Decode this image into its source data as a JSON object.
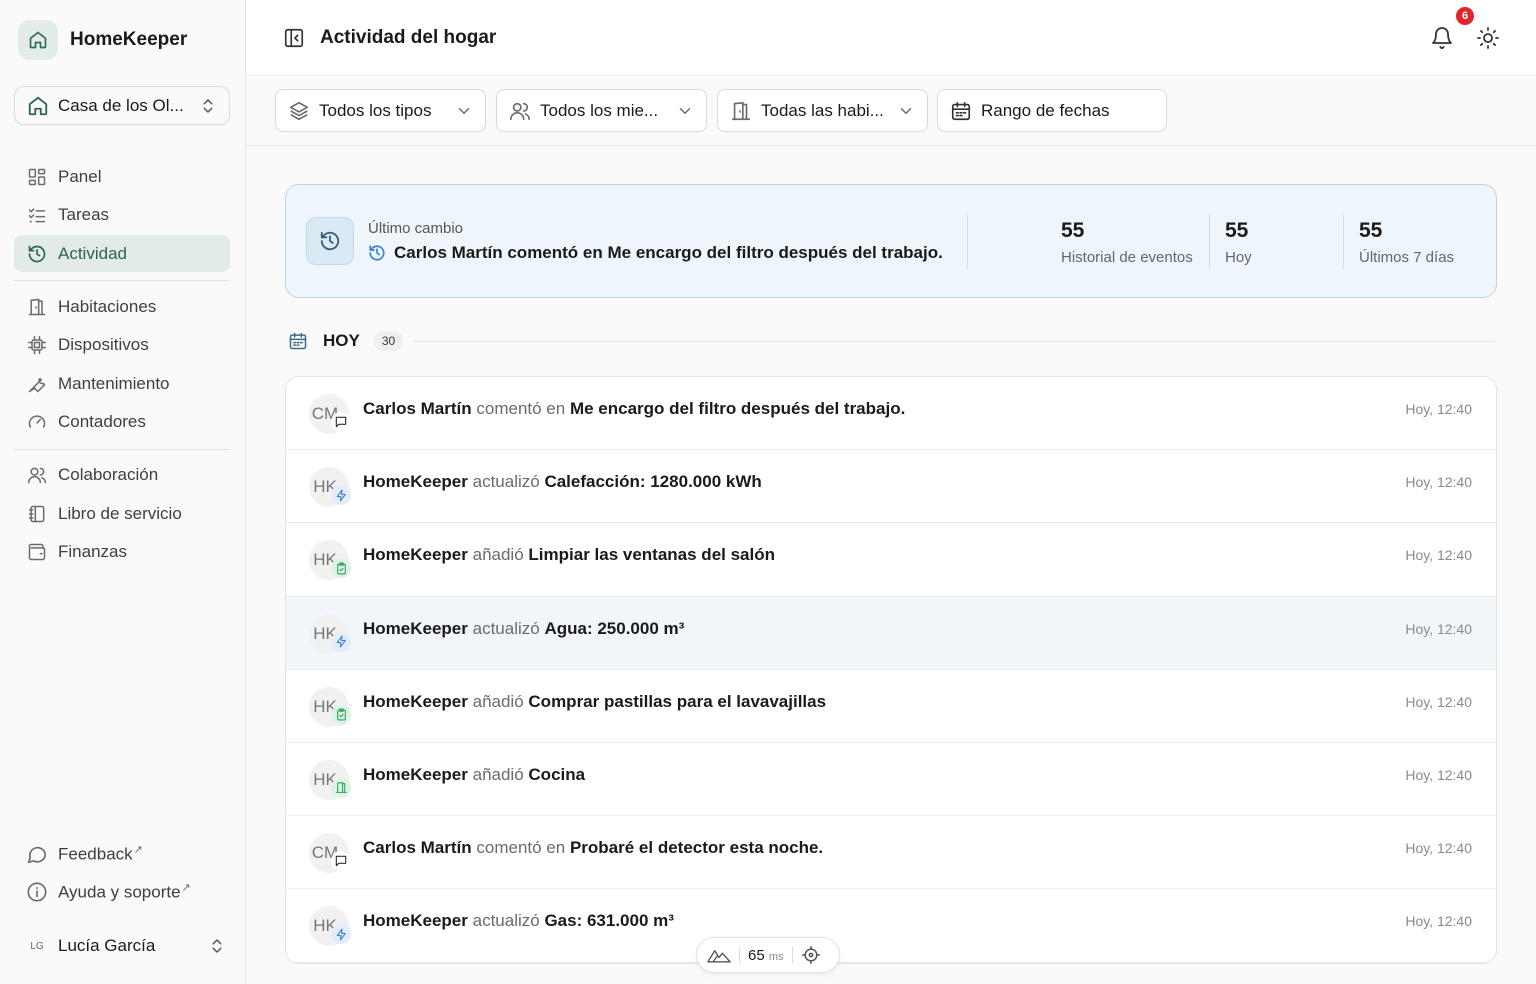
{
  "app": {
    "name": "HomeKeeper"
  },
  "home_selector": {
    "value": "Casa de los Ol..."
  },
  "nav": {
    "primary": [
      {
        "label": "Panel",
        "icon": "grid-icon"
      },
      {
        "label": "Tareas",
        "icon": "list-check-icon"
      },
      {
        "label": "Actividad",
        "icon": "history-icon",
        "active": true
      }
    ],
    "secondary": [
      {
        "label": "Habitaciones",
        "icon": "door-icon"
      },
      {
        "label": "Dispositivos",
        "icon": "chip-icon"
      },
      {
        "label": "Mantenimiento",
        "icon": "wrench-icon"
      },
      {
        "label": "Contadores",
        "icon": "gauge-icon"
      }
    ],
    "tertiary": [
      {
        "label": "Colaboración",
        "icon": "users-icon"
      },
      {
        "label": "Libro de servicio",
        "icon": "notebook-icon"
      },
      {
        "label": "Finanzas",
        "icon": "wallet-icon"
      }
    ],
    "footer": [
      {
        "label": "Feedback",
        "icon": "message-icon",
        "external": "↗"
      },
      {
        "label": "Ayuda y soporte",
        "icon": "info-icon",
        "external": "↗"
      }
    ]
  },
  "user": {
    "initials": "LG",
    "name": "Lucía García"
  },
  "header": {
    "title": "Actividad del hogar",
    "notifications": "6"
  },
  "filters": {
    "types": "Todos los tipos",
    "members": "Todos los mie...",
    "rooms": "Todas las habi...",
    "dates": "Rango de fechas"
  },
  "summary": {
    "label": "Último cambio",
    "message": "Carlos Martín comentó en Me encargo del filtro después del trabajo.",
    "stats": [
      {
        "value": "55",
        "label": "Historial de eventos"
      },
      {
        "value": "55",
        "label": "Hoy"
      },
      {
        "value": "55",
        "label": "Últimos 7 días"
      }
    ]
  },
  "group": {
    "title": "HOY",
    "count": "30"
  },
  "events": [
    {
      "initials": "CM",
      "badge": "chat",
      "actor": "Carlos Martín",
      "verb": "comentó en",
      "target": "Me encargo del filtro después del trabajo.",
      "time": "Hoy, 12:40"
    },
    {
      "initials": "HK",
      "badge": "bolt",
      "actor": "HomeKeeper",
      "verb": "actualizó",
      "target": "Calefacción: 1280.000 kWh",
      "time": "Hoy, 12:40"
    },
    {
      "initials": "HK",
      "badge": "task",
      "actor": "HomeKeeper",
      "verb": "añadió",
      "target": "Limpiar las ventanas del salón",
      "time": "Hoy, 12:40"
    },
    {
      "initials": "HK",
      "badge": "bolt",
      "actor": "HomeKeeper",
      "verb": "actualizó",
      "target": "Agua: 250.000 m³",
      "time": "Hoy, 12:40",
      "highlight": true
    },
    {
      "initials": "HK",
      "badge": "task",
      "actor": "HomeKeeper",
      "verb": "añadió",
      "target": "Comprar pastillas para el lavavajillas",
      "time": "Hoy, 12:40"
    },
    {
      "initials": "HK",
      "badge": "room",
      "actor": "HomeKeeper",
      "verb": "añadió",
      "target": "Cocina",
      "time": "Hoy, 12:40"
    },
    {
      "initials": "CM",
      "badge": "chat",
      "actor": "Carlos Martín",
      "verb": "comentó en",
      "target": "Probaré el detector esta noche.",
      "time": "Hoy, 12:40"
    },
    {
      "initials": "HK",
      "badge": "bolt",
      "actor": "HomeKeeper",
      "verb": "actualizó",
      "target": "Gas: 631.000 m³",
      "time": "Hoy, 12:40"
    }
  ],
  "perf": {
    "value": "65",
    "unit": "ms"
  }
}
